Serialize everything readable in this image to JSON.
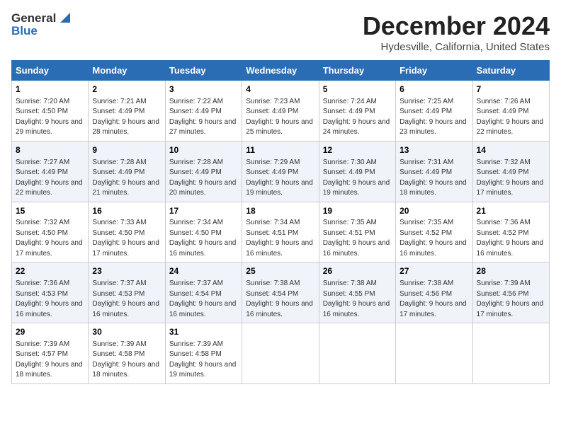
{
  "header": {
    "logo_general": "General",
    "logo_blue": "Blue",
    "month_title": "December 2024",
    "location": "Hydesville, California, United States"
  },
  "days_of_week": [
    "Sunday",
    "Monday",
    "Tuesday",
    "Wednesday",
    "Thursday",
    "Friday",
    "Saturday"
  ],
  "weeks": [
    [
      {
        "day": "1",
        "sunrise": "7:20 AM",
        "sunset": "4:50 PM",
        "daylight": "9 hours and 29 minutes."
      },
      {
        "day": "2",
        "sunrise": "7:21 AM",
        "sunset": "4:49 PM",
        "daylight": "9 hours and 28 minutes."
      },
      {
        "day": "3",
        "sunrise": "7:22 AM",
        "sunset": "4:49 PM",
        "daylight": "9 hours and 27 minutes."
      },
      {
        "day": "4",
        "sunrise": "7:23 AM",
        "sunset": "4:49 PM",
        "daylight": "9 hours and 25 minutes."
      },
      {
        "day": "5",
        "sunrise": "7:24 AM",
        "sunset": "4:49 PM",
        "daylight": "9 hours and 24 minutes."
      },
      {
        "day": "6",
        "sunrise": "7:25 AM",
        "sunset": "4:49 PM",
        "daylight": "9 hours and 23 minutes."
      },
      {
        "day": "7",
        "sunrise": "7:26 AM",
        "sunset": "4:49 PM",
        "daylight": "9 hours and 22 minutes."
      }
    ],
    [
      {
        "day": "8",
        "sunrise": "7:27 AM",
        "sunset": "4:49 PM",
        "daylight": "9 hours and 22 minutes."
      },
      {
        "day": "9",
        "sunrise": "7:28 AM",
        "sunset": "4:49 PM",
        "daylight": "9 hours and 21 minutes."
      },
      {
        "day": "10",
        "sunrise": "7:28 AM",
        "sunset": "4:49 PM",
        "daylight": "9 hours and 20 minutes."
      },
      {
        "day": "11",
        "sunrise": "7:29 AM",
        "sunset": "4:49 PM",
        "daylight": "9 hours and 19 minutes."
      },
      {
        "day": "12",
        "sunrise": "7:30 AM",
        "sunset": "4:49 PM",
        "daylight": "9 hours and 19 minutes."
      },
      {
        "day": "13",
        "sunrise": "7:31 AM",
        "sunset": "4:49 PM",
        "daylight": "9 hours and 18 minutes."
      },
      {
        "day": "14",
        "sunrise": "7:32 AM",
        "sunset": "4:49 PM",
        "daylight": "9 hours and 17 minutes."
      }
    ],
    [
      {
        "day": "15",
        "sunrise": "7:32 AM",
        "sunset": "4:50 PM",
        "daylight": "9 hours and 17 minutes."
      },
      {
        "day": "16",
        "sunrise": "7:33 AM",
        "sunset": "4:50 PM",
        "daylight": "9 hours and 17 minutes."
      },
      {
        "day": "17",
        "sunrise": "7:34 AM",
        "sunset": "4:50 PM",
        "daylight": "9 hours and 16 minutes."
      },
      {
        "day": "18",
        "sunrise": "7:34 AM",
        "sunset": "4:51 PM",
        "daylight": "9 hours and 16 minutes."
      },
      {
        "day": "19",
        "sunrise": "7:35 AM",
        "sunset": "4:51 PM",
        "daylight": "9 hours and 16 minutes."
      },
      {
        "day": "20",
        "sunrise": "7:35 AM",
        "sunset": "4:52 PM",
        "daylight": "9 hours and 16 minutes."
      },
      {
        "day": "21",
        "sunrise": "7:36 AM",
        "sunset": "4:52 PM",
        "daylight": "9 hours and 16 minutes."
      }
    ],
    [
      {
        "day": "22",
        "sunrise": "7:36 AM",
        "sunset": "4:53 PM",
        "daylight": "9 hours and 16 minutes."
      },
      {
        "day": "23",
        "sunrise": "7:37 AM",
        "sunset": "4:53 PM",
        "daylight": "9 hours and 16 minutes."
      },
      {
        "day": "24",
        "sunrise": "7:37 AM",
        "sunset": "4:54 PM",
        "daylight": "9 hours and 16 minutes."
      },
      {
        "day": "25",
        "sunrise": "7:38 AM",
        "sunset": "4:54 PM",
        "daylight": "9 hours and 16 minutes."
      },
      {
        "day": "26",
        "sunrise": "7:38 AM",
        "sunset": "4:55 PM",
        "daylight": "9 hours and 16 minutes."
      },
      {
        "day": "27",
        "sunrise": "7:38 AM",
        "sunset": "4:56 PM",
        "daylight": "9 hours and 17 minutes."
      },
      {
        "day": "28",
        "sunrise": "7:39 AM",
        "sunset": "4:56 PM",
        "daylight": "9 hours and 17 minutes."
      }
    ],
    [
      {
        "day": "29",
        "sunrise": "7:39 AM",
        "sunset": "4:57 PM",
        "daylight": "9 hours and 18 minutes."
      },
      {
        "day": "30",
        "sunrise": "7:39 AM",
        "sunset": "4:58 PM",
        "daylight": "9 hours and 18 minutes."
      },
      {
        "day": "31",
        "sunrise": "7:39 AM",
        "sunset": "4:58 PM",
        "daylight": "9 hours and 19 minutes."
      },
      null,
      null,
      null,
      null
    ]
  ],
  "labels": {
    "sunrise": "Sunrise:",
    "sunset": "Sunset:",
    "daylight": "Daylight:"
  }
}
